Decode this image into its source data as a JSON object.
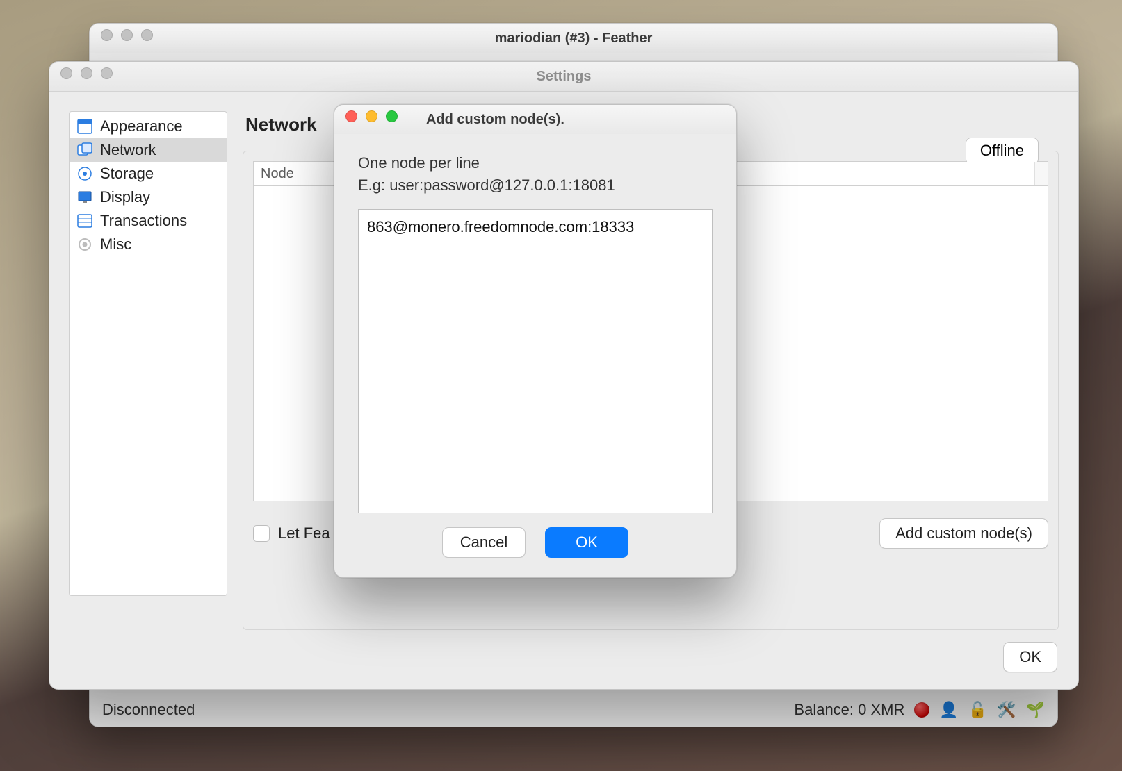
{
  "main_window": {
    "title": "mariodian (#3) - Feather"
  },
  "status": {
    "left": "Disconnected",
    "balance_label": "Balance: 0 XMR"
  },
  "settings": {
    "title": "Settings",
    "section_heading": "Network",
    "sidebar": {
      "items": [
        {
          "label": "Appearance"
        },
        {
          "label": "Network"
        },
        {
          "label": "Storage"
        },
        {
          "label": "Display"
        },
        {
          "label": "Transactions"
        },
        {
          "label": "Misc"
        }
      ],
      "selected_index": 1
    },
    "tabs": {
      "offline_label": "Offline"
    },
    "table": {
      "node_header": "Node"
    },
    "let_feather_label": "Let Fea",
    "add_custom_label": "Add custom node(s)",
    "ok_label": "OK"
  },
  "dialog": {
    "title": "Add custom node(s).",
    "hint_line1": "One node per line",
    "hint_line2": "E.g: user:password@127.0.0.1:18081",
    "text_value": "863@monero.freedomnode.com:18333",
    "cancel_label": "Cancel",
    "ok_label": "OK"
  }
}
